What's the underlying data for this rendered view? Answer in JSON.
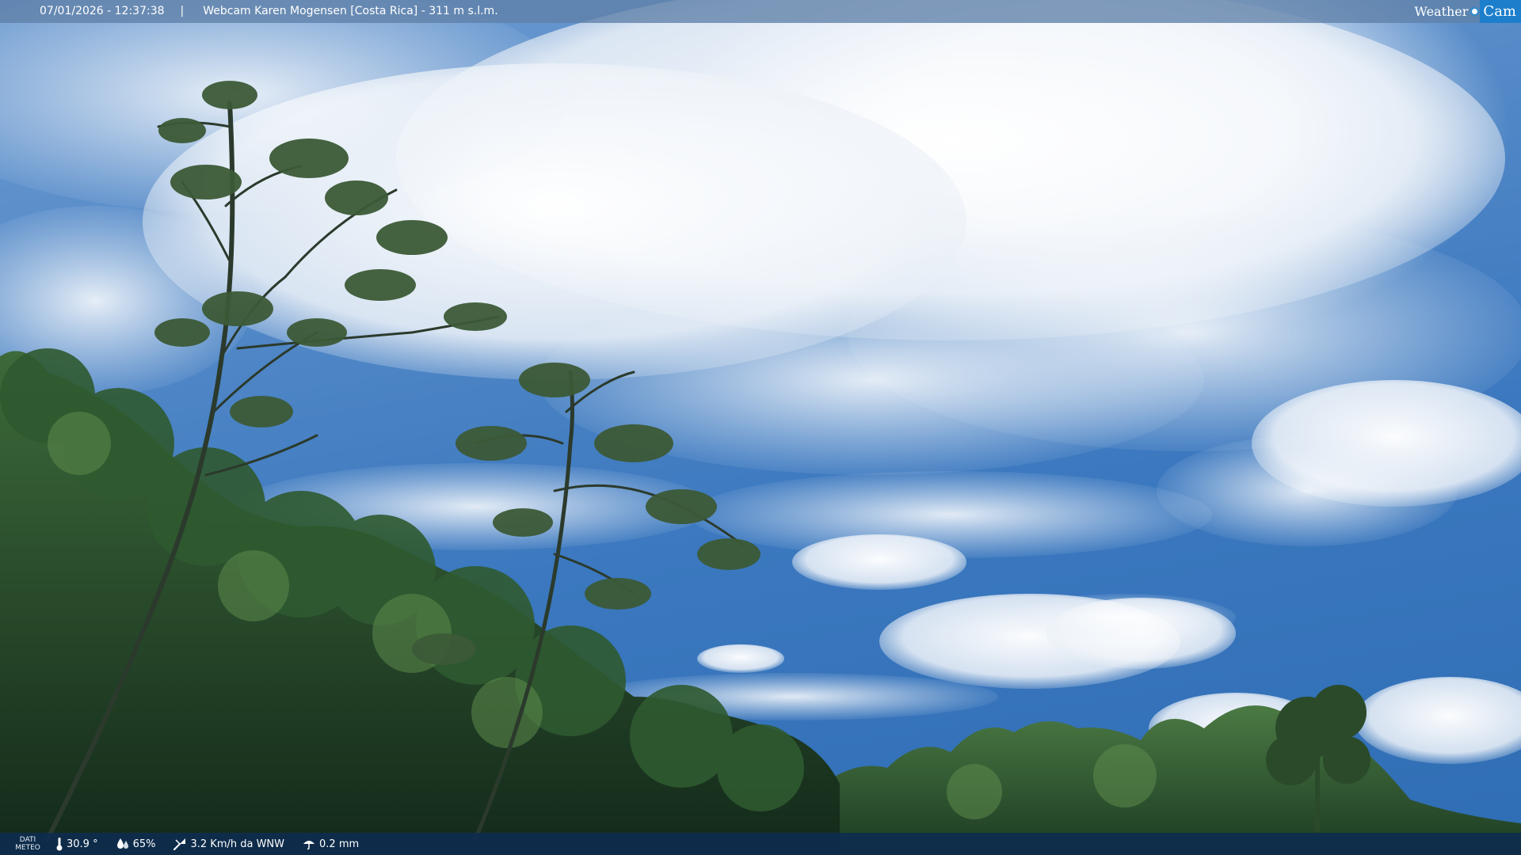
{
  "topbar": {
    "datetime": "07/01/2026 - 12:37:38",
    "separator": "|",
    "title": "Webcam Karen Mogensen [Costa Rica] - 311 m s.l.m."
  },
  "logo": {
    "weather": "Weather",
    "cam": "Cam"
  },
  "weather_data": {
    "label_line1": "DATI",
    "label_line2": "METEO",
    "temperature": "30.9 °",
    "humidity": "65%",
    "wind": "3.2 Km/h da WNW",
    "rain": "0.2 mm"
  },
  "icons": {
    "temperature": "thermometer-icon",
    "humidity": "droplet-icon",
    "wind": "wind-icon",
    "rain": "rain-icon"
  },
  "colors": {
    "topbar": "#5f80a8",
    "bottombar": "#0e2c4e",
    "logo_accent": "#1d7fcc"
  }
}
